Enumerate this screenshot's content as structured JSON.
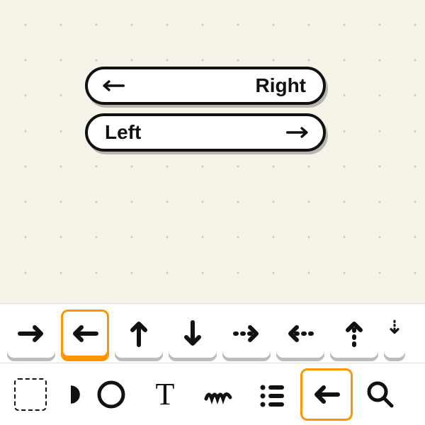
{
  "canvas": {
    "pill1": {
      "text": "Right",
      "arrow": "arrow-left-icon"
    },
    "pill2": {
      "text": "Left",
      "arrow": "arrow-right-icon"
    }
  },
  "arrow_picker": {
    "selected_index": 1,
    "options": [
      "arrow-right-icon",
      "arrow-left-icon",
      "arrow-up-icon",
      "arrow-down-icon",
      "arrow-right-dotted-icon",
      "arrow-left-dotted-icon",
      "arrow-up-dotted-icon",
      "arrow-down-dotted-icon"
    ]
  },
  "toolbar": {
    "selected_index": 5,
    "tools": [
      "select-tool",
      "shape-tool",
      "circle-tool",
      "text-tool",
      "pen-tool",
      "list-tool",
      "arrow-tool",
      "search-tool"
    ]
  }
}
